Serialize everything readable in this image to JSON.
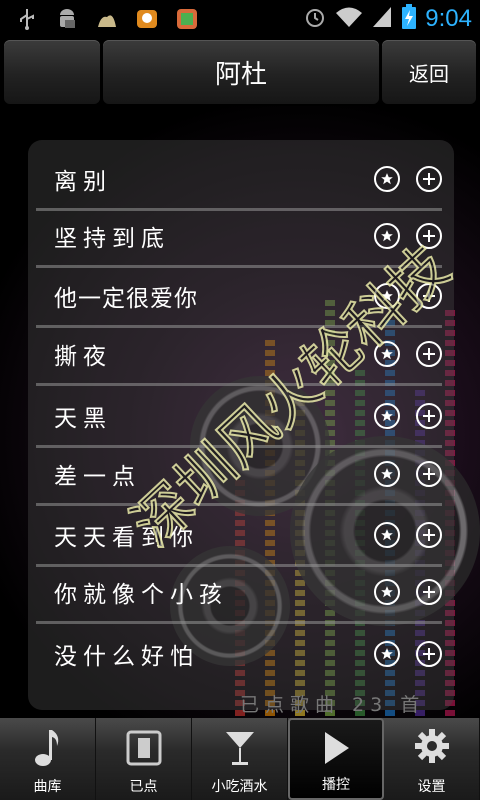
{
  "status_bar": {
    "time": "9:04",
    "icons": [
      "usb-icon",
      "android-icon",
      "notification-icon",
      "chat-icon",
      "app-icon",
      "alarm-icon",
      "wifi-icon",
      "signal-icon",
      "battery-charging-icon"
    ],
    "time_color": "#2db3ff"
  },
  "header": {
    "title": "阿杜",
    "back_label": "返回"
  },
  "songs": [
    {
      "title": "离别"
    },
    {
      "title": "坚持到底"
    },
    {
      "title": "他一定很爱你"
    },
    {
      "title": "撕夜"
    },
    {
      "title": "天黑"
    },
    {
      "title": "差一点"
    },
    {
      "title": "天天看到你"
    },
    {
      "title": "你就像个小孩"
    },
    {
      "title": "没什么好怕"
    }
  ],
  "selected_count": {
    "text": "已点歌曲  23  首"
  },
  "tabs": [
    {
      "label": "曲库",
      "icon": "music-note-icon"
    },
    {
      "label": "已点",
      "icon": "playlist-icon"
    },
    {
      "label": "小吃酒水",
      "icon": "cocktail-icon"
    },
    {
      "label": "播控",
      "icon": "play-icon",
      "active": true
    },
    {
      "label": "设置",
      "icon": "gear-icon"
    }
  ],
  "watermark": "深圳风火轮科技"
}
